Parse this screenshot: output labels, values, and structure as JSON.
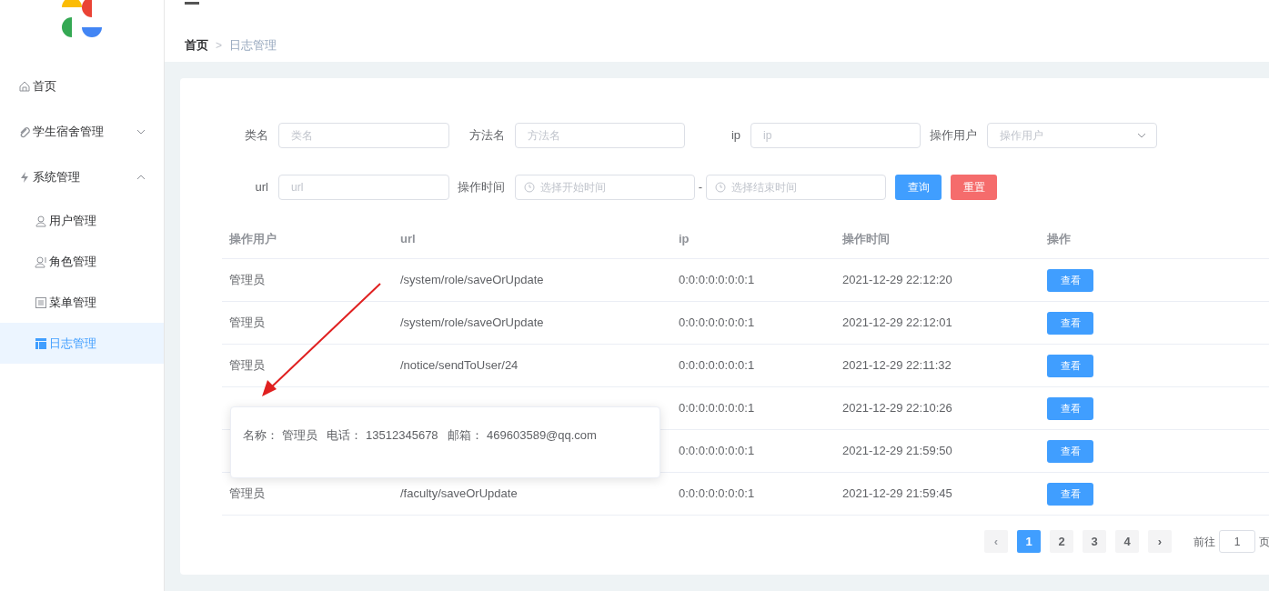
{
  "sidebar": {
    "items": [
      {
        "label": "首页",
        "selected": false
      },
      {
        "label": "学生宿舍管理",
        "expanded": false
      },
      {
        "label": "系统管理",
        "expanded": true,
        "children": [
          {
            "label": "用户管理",
            "selected": false
          },
          {
            "label": "角色管理",
            "selected": false
          },
          {
            "label": "菜单管理",
            "selected": false
          },
          {
            "label": "日志管理",
            "selected": true
          }
        ]
      }
    ]
  },
  "breadcrumb": {
    "items": [
      "首页",
      "日志管理"
    ],
    "separator": ">"
  },
  "filters": [
    [
      {
        "label": "类名",
        "placeholder": "类名",
        "kind": "text"
      },
      {
        "label": "方法名",
        "placeholder": "方法名",
        "kind": "text"
      },
      {
        "label": "ip",
        "placeholder": "ip",
        "kind": "text"
      },
      {
        "label": "操作用户",
        "placeholder": "操作用户",
        "kind": "select"
      }
    ],
    [
      {
        "label": "url",
        "placeholder": "url",
        "kind": "text"
      },
      {
        "label": "操作时间",
        "placeholder": "选择开始时间",
        "kind": "date"
      },
      {
        "label": "-",
        "placeholder": "选择结束时间",
        "kind": "date"
      }
    ]
  ],
  "buttons": [
    {
      "label": "查询",
      "kind": "primary"
    },
    {
      "label": "重置",
      "kind": "danger"
    }
  ],
  "table": {
    "columns": [
      "操作用户",
      "url",
      "ip",
      "操作时间",
      "操作"
    ],
    "rows": [
      {
        "user": "管理员",
        "url": "/system/role/saveOrUpdate",
        "ip": "0:0:0:0:0:0:0:1",
        "time": "2021-12-29 22:12:20",
        "action": "查看"
      },
      {
        "user": "管理员",
        "url": "/system/role/saveOrUpdate",
        "ip": "0:0:0:0:0:0:0:1",
        "time": "2021-12-29 22:12:01",
        "action": "查看"
      },
      {
        "user": "管理员",
        "url": "/notice/sendToUser/24",
        "ip": "0:0:0:0:0:0:0:1",
        "time": "2021-12-29 22:11:32",
        "action": "查看"
      },
      {
        "ip": "0:0:0:0:0:0:0:1",
        "time": "2021-12-29 22:10:26",
        "action": "查看"
      },
      {
        "ip": "0:0:0:0:0:0:0:1",
        "time": "2021-12-29 21:59:50",
        "action": "查看"
      },
      {
        "user": "管理员",
        "url": "/faculty/saveOrUpdate",
        "ip": "0:0:0:0:0:0:0:1",
        "time": "2021-12-29 21:59:45",
        "action": "查看"
      }
    ]
  },
  "tooltip": {
    "text": "名称： 管理员   电话： 13512345678   邮箱： 469603589@qq.com"
  },
  "pagination": {
    "prev": "‹",
    "next": "›",
    "pages": [
      {
        "label": "1",
        "selected": true
      },
      {
        "label": "2",
        "selected": false
      },
      {
        "label": "3",
        "selected": false
      },
      {
        "label": "4",
        "selected": false
      }
    ],
    "goto_label": "前往",
    "goto_value": "1",
    "goto_suffix": "页"
  }
}
